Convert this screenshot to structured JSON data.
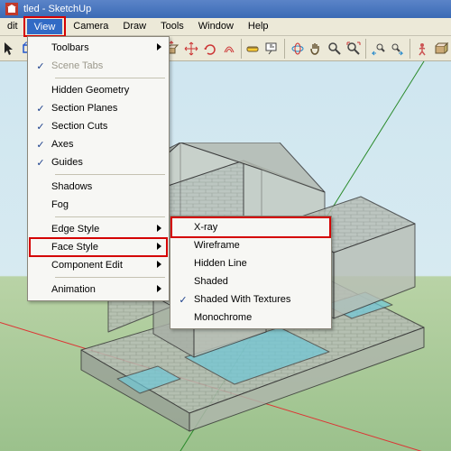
{
  "window": {
    "title": "tled - SketchUp"
  },
  "menubar": {
    "items": [
      "dit",
      "View",
      "Camera",
      "Draw",
      "Tools",
      "Window",
      "Help"
    ],
    "active_index": 1
  },
  "toolbar_icons": [
    "select-arrow-icon",
    "make-component-icon",
    "paint-bucket-icon",
    "eraser-icon",
    "sep",
    "pencil-icon",
    "rectangle-icon",
    "circle-icon",
    "arc-icon",
    "sep",
    "push-pull-icon",
    "move-icon",
    "rotate-icon",
    "offset-icon",
    "sep",
    "tape-measure-icon",
    "text-icon",
    "sep",
    "orbit-icon",
    "pan-icon",
    "zoom-icon",
    "zoom-extents-icon",
    "sep",
    "prev-view-icon",
    "next-view-icon",
    "sep",
    "person-icon",
    "get-models-icon"
  ],
  "view_menu": {
    "items": [
      {
        "label": "Toolbars",
        "submenu": true
      },
      {
        "label": "Scene Tabs",
        "checked": true,
        "disabled": true
      },
      {
        "sep": true
      },
      {
        "label": "Hidden Geometry"
      },
      {
        "label": "Section Planes",
        "checked": true
      },
      {
        "label": "Section Cuts",
        "checked": true
      },
      {
        "label": "Axes",
        "checked": true
      },
      {
        "label": "Guides",
        "checked": true
      },
      {
        "sep": true
      },
      {
        "label": "Shadows"
      },
      {
        "label": "Fog"
      },
      {
        "sep": true
      },
      {
        "label": "Edge Style",
        "submenu": true
      },
      {
        "label": "Face Style",
        "submenu": true,
        "highlighted": true
      },
      {
        "label": "Component Edit",
        "submenu": true
      },
      {
        "sep": true
      },
      {
        "label": "Animation",
        "submenu": true
      }
    ]
  },
  "face_style_submenu": {
    "items": [
      {
        "label": "X-ray",
        "highlighted": true
      },
      {
        "label": "Wireframe"
      },
      {
        "label": "Hidden Line"
      },
      {
        "label": "Shaded"
      },
      {
        "label": "Shaded With Textures",
        "checked": true
      },
      {
        "label": "Monochrome"
      }
    ]
  }
}
